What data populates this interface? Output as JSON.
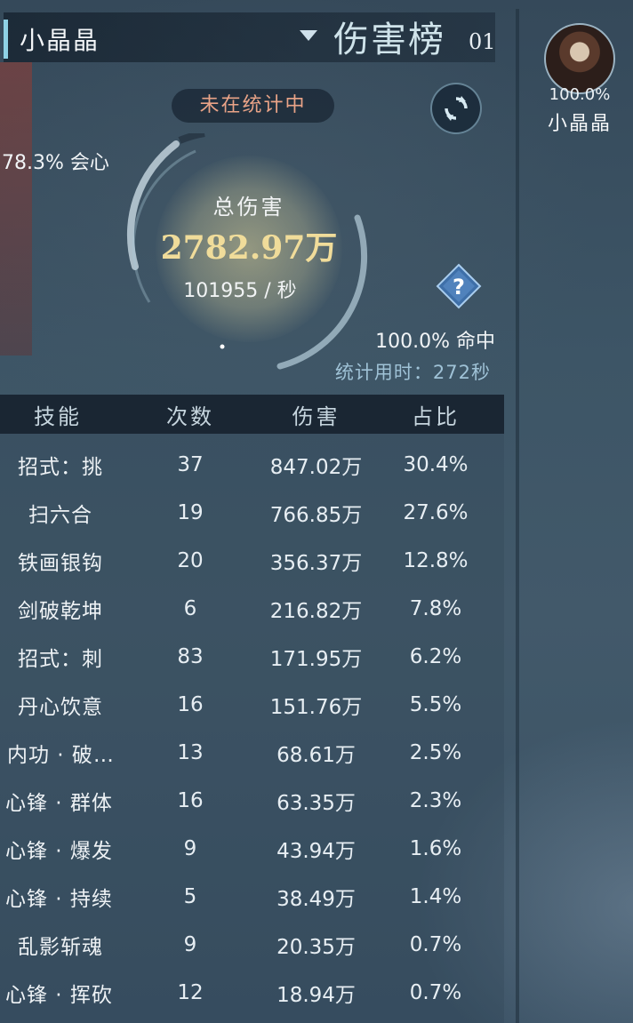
{
  "header": {
    "player_name": "小晶晶",
    "board_title": "伤害榜",
    "board_number": "01"
  },
  "status": {
    "label": "未在统计中"
  },
  "stats": {
    "crit_text": "78.3% 会心",
    "hit_text": "100.0% 命中",
    "time_text": "统计用时：272秒",
    "total_label": "总伤害",
    "total_value": "2782.97万",
    "dps_text": "101955 / 秒"
  },
  "table": {
    "headers": [
      "技能",
      "次数",
      "伤害",
      "占比"
    ],
    "rows": [
      {
        "skill": "招式：挑",
        "count": "37",
        "damage": "847.02万",
        "percent": "30.4%"
      },
      {
        "skill": "扫六合",
        "count": "19",
        "damage": "766.85万",
        "percent": "27.6%"
      },
      {
        "skill": "铁画银钩",
        "count": "20",
        "damage": "356.37万",
        "percent": "12.8%"
      },
      {
        "skill": "剑破乾坤",
        "count": "6",
        "damage": "216.82万",
        "percent": "7.8%"
      },
      {
        "skill": "招式：刺",
        "count": "83",
        "damage": "171.95万",
        "percent": "6.2%"
      },
      {
        "skill": "丹心饮意",
        "count": "16",
        "damage": "151.76万",
        "percent": "5.5%"
      },
      {
        "skill": "内功 · 破…",
        "count": "13",
        "damage": "68.61万",
        "percent": "2.5%"
      },
      {
        "skill": "心锋 · 群体",
        "count": "16",
        "damage": "63.35万",
        "percent": "2.3%"
      },
      {
        "skill": "心锋 · 爆发",
        "count": "9",
        "damage": "43.94万",
        "percent": "1.6%"
      },
      {
        "skill": "心锋 · 持续",
        "count": "5",
        "damage": "38.49万",
        "percent": "1.4%"
      },
      {
        "skill": "乱影斩魂",
        "count": "9",
        "damage": "20.35万",
        "percent": "0.7%"
      },
      {
        "skill": "心锋 · 挥砍",
        "count": "12",
        "damage": "18.94万",
        "percent": "0.7%"
      }
    ]
  },
  "player_card": {
    "percent": "100.0%",
    "name": "小晶晶"
  },
  "icons": {
    "dropdown": "triangle-down-icon",
    "refresh": "refresh-icon",
    "help": "question-diamond-icon"
  },
  "colors": {
    "accent": "#8ed1e5",
    "total_value": "#f0dc9a",
    "status_text": "#e9a387"
  }
}
